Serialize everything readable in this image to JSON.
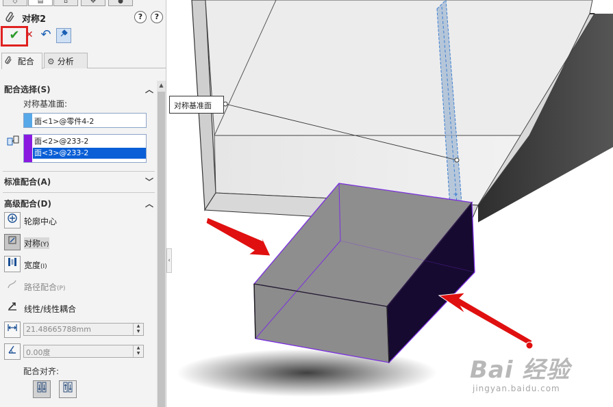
{
  "panel": {
    "title": "对称2",
    "help_label": "?",
    "help2_label": "?",
    "ok_label": "✔",
    "cancel_label": "✕",
    "undo_label": "↶",
    "pin_label": "✓",
    "subtabs": [
      {
        "icon": "📎",
        "label": "配合"
      },
      {
        "icon": "⚙",
        "label": "分析"
      }
    ],
    "mate_selections": {
      "heading": "配合选择(S)",
      "symmetry_plane_label": "对称基准面:",
      "symmetry_plane_value": "面<1>@零件4-2",
      "entities": [
        "面<2>@233-2",
        "面<3>@233-2"
      ]
    },
    "standard_mates": {
      "heading": "标准配合(A)"
    },
    "advanced_mates": {
      "heading": "高级配合(D)",
      "items": [
        {
          "label": "轮廓中心",
          "shortcut": ""
        },
        {
          "label": "对称",
          "shortcut": "(Y)"
        },
        {
          "label": "宽度",
          "shortcut": "(I)"
        },
        {
          "label": "路径配合",
          "shortcut": "(P)"
        },
        {
          "label": "线性/线性耦合",
          "shortcut": ""
        }
      ],
      "distance_value": "21.48665788mm",
      "angle_value": "0.00度",
      "alignment_label": "配合对齐:"
    }
  },
  "viewport": {
    "callout_text": "对称基准面",
    "watermark_main": "Bai 经验",
    "watermark_sub": "jingyan.baidu.com"
  },
  "colors": {
    "accent": "#0a5fd6",
    "ok_highlight": "#e02020",
    "selection_purple": "#8a1ae0",
    "plane_blue": "#56a8e8",
    "arrow_red": "#e01010"
  }
}
